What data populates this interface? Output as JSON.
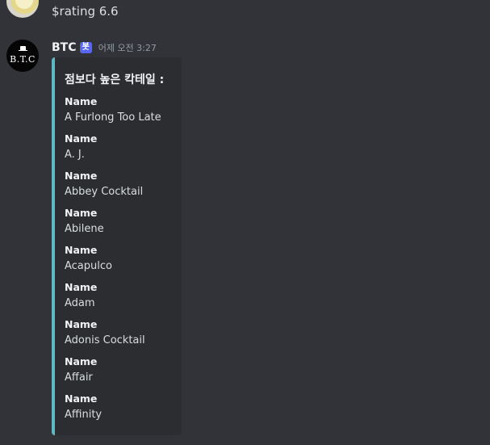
{
  "previous_message": {
    "text": "$rating 6.6"
  },
  "bot_message": {
    "username": "BTC",
    "badge": "봇",
    "timestamp": "어제 오전 3:27",
    "avatar_text": "B.T.C",
    "embed": {
      "accent_color": "#5eb7c4",
      "title": "점보다 높은 칵테일 :",
      "fields": [
        {
          "name": "Name",
          "value": "A Furlong Too Late"
        },
        {
          "name": "Name",
          "value": "A. J."
        },
        {
          "name": "Name",
          "value": "Abbey Cocktail"
        },
        {
          "name": "Name",
          "value": "Abilene"
        },
        {
          "name": "Name",
          "value": "Acapulco"
        },
        {
          "name": "Name",
          "value": "Adam"
        },
        {
          "name": "Name",
          "value": "Adonis Cocktail"
        },
        {
          "name": "Name",
          "value": "Affair"
        },
        {
          "name": "Name",
          "value": "Affinity"
        }
      ]
    }
  },
  "colors": {
    "background": "#313338",
    "embed_background": "#2b2d31",
    "bot_badge": "#5865f2"
  }
}
